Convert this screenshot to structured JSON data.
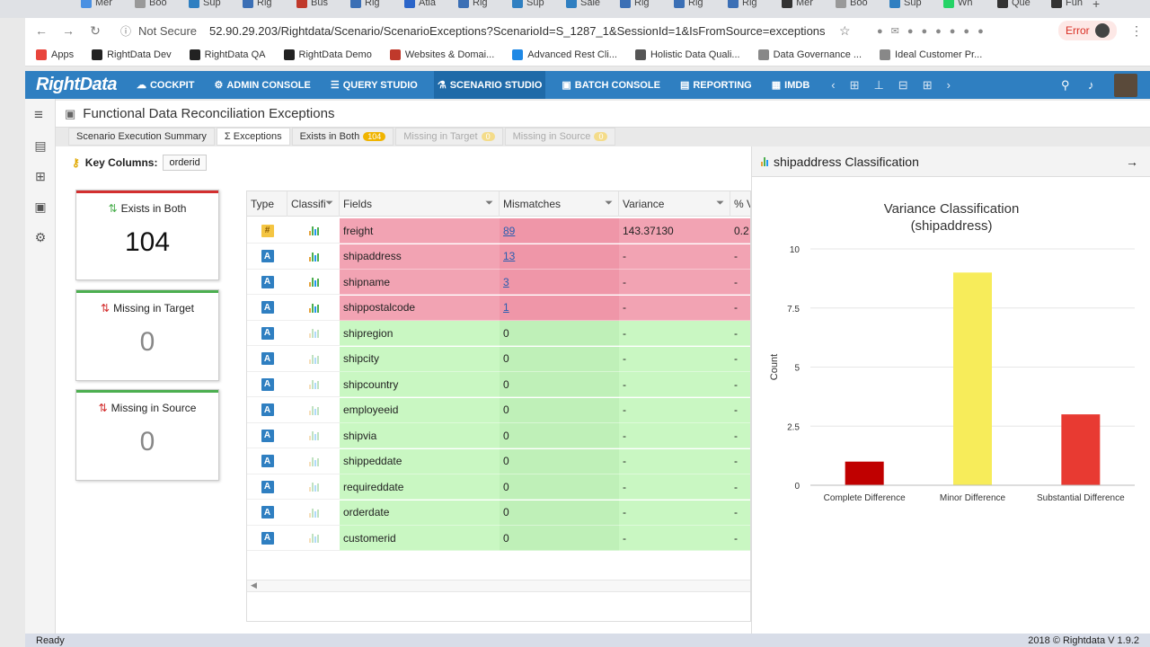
{
  "browser": {
    "tabs": [
      {
        "label": "Mer",
        "color": "#4a90e2"
      },
      {
        "label": "Boo",
        "color": "#999"
      },
      {
        "label": "Sup",
        "color": "#2f7fc1"
      },
      {
        "label": "Rig",
        "color": "#3b6fb5"
      },
      {
        "label": "Bus",
        "color": "#c0392b"
      },
      {
        "label": "Rig",
        "color": "#3b6fb5"
      },
      {
        "label": "Atla",
        "color": "#2b65c9"
      },
      {
        "label": "Rig",
        "color": "#3b6fb5"
      },
      {
        "label": "Sup",
        "color": "#2f7fc1"
      },
      {
        "label": "Sale",
        "color": "#2f7fc1"
      },
      {
        "label": "Rig",
        "color": "#3b6fb5"
      },
      {
        "label": "Rig",
        "color": "#3b6fb5"
      },
      {
        "label": "Rig",
        "color": "#3b6fb5"
      },
      {
        "label": "Mer",
        "color": "#333"
      },
      {
        "label": "Boo",
        "color": "#999"
      },
      {
        "label": "Sup",
        "color": "#2f7fc1"
      },
      {
        "label": "Wh",
        "color": "#25d366"
      },
      {
        "label": "Que",
        "color": "#333"
      },
      {
        "label": "Fun",
        "color": "#333"
      }
    ],
    "security": "Not Secure",
    "url": "52.90.29.203/Rightdata/Scenario/ScenarioExceptions?ScenarioId=S_1287_1&SessionId=1&IsFromSource=exceptions",
    "error_label": "Error",
    "bookmarks": [
      {
        "label": "Apps",
        "color": "#e8453c"
      },
      {
        "label": "RightData Dev",
        "color": "#222"
      },
      {
        "label": "RightData QA",
        "color": "#222"
      },
      {
        "label": "RightData Demo",
        "color": "#222"
      },
      {
        "label": "Websites & Domai...",
        "color": "#c0392b"
      },
      {
        "label": "Advanced Rest Cli...",
        "color": "#1e88e5"
      },
      {
        "label": "Holistic Data Quali...",
        "color": "#555"
      },
      {
        "label": "Data Governance ...",
        "color": "#888"
      },
      {
        "label": "Ideal Customer Pr...",
        "color": "#888"
      }
    ]
  },
  "app": {
    "logo": "RightData",
    "nav": [
      "COCKPIT",
      "ADMIN CONSOLE",
      "QUERY STUDIO",
      "SCENARIO STUDIO",
      "BATCH CONSOLE",
      "REPORTING",
      "IMDB"
    ],
    "active_nav": "SCENARIO STUDIO"
  },
  "page": {
    "title": "Functional Data Reconciliation Exceptions",
    "subtabs": [
      {
        "label": "Scenario Execution Summary"
      },
      {
        "label": "Σ Exceptions"
      },
      {
        "label": "Exists in Both",
        "badge": "104"
      },
      {
        "label": "Missing in Target",
        "badge": "0"
      },
      {
        "label": "Missing in Source",
        "badge": "0"
      }
    ],
    "key_columns_label": "Key Columns:",
    "key_columns_value": "orderid"
  },
  "cards": [
    {
      "label": "Exists in Both",
      "value": "104",
      "bar_color": "#d32f2f"
    },
    {
      "label": "Missing in Target",
      "value": "0",
      "bar_color": "#4caf50"
    },
    {
      "label": "Missing in Source",
      "value": "0",
      "bar_color": "#4caf50"
    }
  ],
  "grid": {
    "headers": [
      "Type",
      "Classifi",
      "Fields",
      "Mismatches",
      "Variance",
      "% V"
    ],
    "rows": [
      {
        "type": "#",
        "field": "freight",
        "mismatches": "89",
        "variance": "143.37130",
        "pct": "0.2",
        "status": "mismatch"
      },
      {
        "type": "A",
        "field": "shipaddress",
        "mismatches": "13",
        "variance": "-",
        "pct": "-",
        "status": "mismatch"
      },
      {
        "type": "A",
        "field": "shipname",
        "mismatches": "3",
        "variance": "-",
        "pct": "-",
        "status": "mismatch"
      },
      {
        "type": "A",
        "field": "shippostalcode",
        "mismatches": "1",
        "variance": "-",
        "pct": "-",
        "status": "mismatch"
      },
      {
        "type": "A",
        "field": "shipregion",
        "mismatches": "0",
        "variance": "-",
        "pct": "-",
        "status": "ok"
      },
      {
        "type": "A",
        "field": "shipcity",
        "mismatches": "0",
        "variance": "-",
        "pct": "-",
        "status": "ok"
      },
      {
        "type": "A",
        "field": "shipcountry",
        "mismatches": "0",
        "variance": "-",
        "pct": "-",
        "status": "ok"
      },
      {
        "type": "A",
        "field": "employeeid",
        "mismatches": "0",
        "variance": "-",
        "pct": "-",
        "status": "ok"
      },
      {
        "type": "A",
        "field": "shipvia",
        "mismatches": "0",
        "variance": "-",
        "pct": "-",
        "status": "ok"
      },
      {
        "type": "A",
        "field": "shippeddate",
        "mismatches": "0",
        "variance": "-",
        "pct": "-",
        "status": "ok"
      },
      {
        "type": "A",
        "field": "requireddate",
        "mismatches": "0",
        "variance": "-",
        "pct": "-",
        "status": "ok"
      },
      {
        "type": "A",
        "field": "orderdate",
        "mismatches": "0",
        "variance": "-",
        "pct": "-",
        "status": "ok"
      },
      {
        "type": "A",
        "field": "customerid",
        "mismatches": "0",
        "variance": "-",
        "pct": "-",
        "status": "ok"
      }
    ]
  },
  "panel": {
    "title": "shipaddress Classification"
  },
  "chart_data": {
    "type": "bar",
    "title": "Variance Classification\n(shipaddress)",
    "categories": [
      "Complete Difference",
      "Minor Difference",
      "Substantial Difference"
    ],
    "values": [
      1,
      9,
      3
    ],
    "colors": [
      "#c00000",
      "#f7ec5a",
      "#e83a32"
    ],
    "ylabel": "Count",
    "xlabel": "",
    "yticks": [
      "0",
      "2.5",
      "5",
      "7.5",
      "10"
    ],
    "ylim": [
      0,
      10
    ],
    "grid": true
  },
  "status": {
    "left": "Ready",
    "right": "2018 © Rightdata V 1.9.2"
  }
}
